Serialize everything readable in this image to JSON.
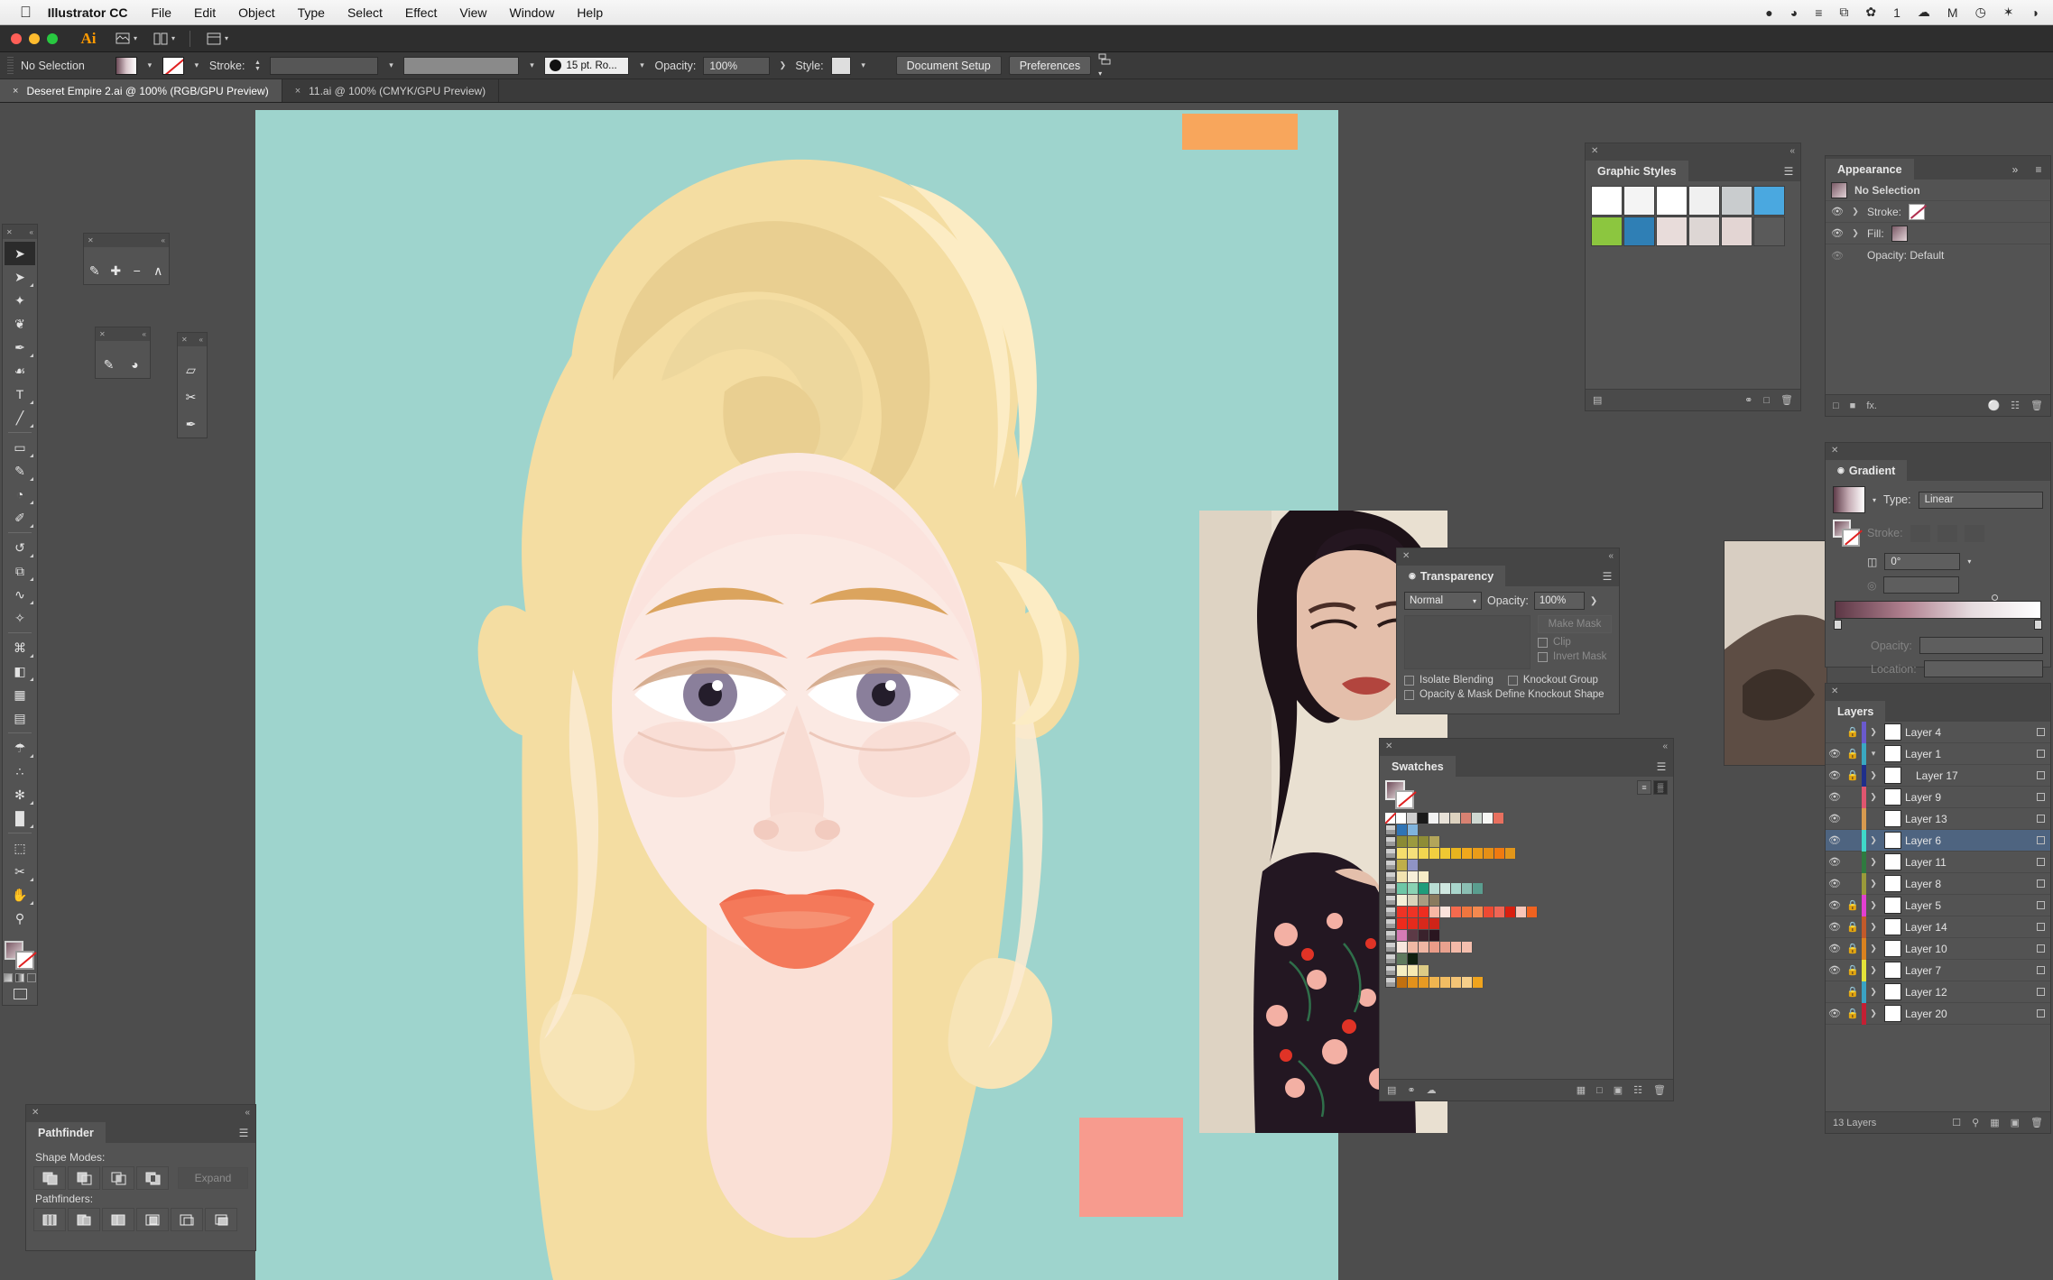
{
  "macbar": {
    "apple_icon": "apple-icon",
    "app_name": "Illustrator CC",
    "menus": [
      "File",
      "Edit",
      "Object",
      "Type",
      "Select",
      "Effect",
      "View",
      "Window",
      "Help"
    ],
    "status_items": [
      {
        "icon": "penguin-icon",
        "label": "●"
      },
      {
        "icon": "globe-icon",
        "label": "◕"
      },
      {
        "icon": "list-check-icon",
        "label": "≡"
      },
      {
        "icon": "screenshot-icon",
        "label": "⧉"
      },
      {
        "icon": "wechat-icon",
        "label": "✿"
      },
      {
        "icon": "count-badge",
        "label": "1"
      },
      {
        "icon": "cloud-icon",
        "label": "☁"
      },
      {
        "icon": "mendeley-icon",
        "label": "M"
      },
      {
        "icon": "clock-icon",
        "label": "◷"
      },
      {
        "icon": "bluetooth-icon",
        "label": "✶"
      },
      {
        "icon": "wifi-icon",
        "label": "◑"
      }
    ]
  },
  "appbar": {
    "logo_text": "Ai",
    "icons": [
      "bridge-icon",
      "arrange-documents-icon",
      "workspace-icon"
    ]
  },
  "controlbar": {
    "selection_status": "No Selection",
    "fill_label": "fill-swatch",
    "stroke_label": "Stroke:",
    "stroke_weight": "",
    "stroke_profile": "",
    "brush_definition": "15 pt. Ro...",
    "opacity_label": "Opacity:",
    "opacity_value": "100%",
    "style_label": "Style:",
    "document_setup_button": "Document Setup",
    "preferences_button": "Preferences"
  },
  "document_tabs": [
    {
      "title": "Deseret Empire 2.ai @ 100% (RGB/GPU Preview)",
      "active": true,
      "close": "×"
    },
    {
      "title": "11.ai @ 100% (CMYK/GPU Preview)",
      "active": false,
      "close": "×"
    }
  ],
  "toolbar": {
    "tools": [
      {
        "name": "selection-tool",
        "glyph": "➤",
        "selected": true,
        "arrow": false
      },
      {
        "name": "direct-selection-tool",
        "glyph": "➤",
        "selected": false,
        "arrow": true
      },
      {
        "name": "magic-wand-tool",
        "glyph": "✦",
        "selected": false,
        "arrow": false
      },
      {
        "name": "lasso-tool",
        "glyph": "❦",
        "selected": false,
        "arrow": false
      },
      {
        "name": "pen-tool",
        "glyph": "✒",
        "selected": false,
        "arrow": true
      },
      {
        "name": "curvature-tool",
        "glyph": "☙",
        "selected": false,
        "arrow": false
      },
      {
        "name": "type-tool",
        "glyph": "T",
        "selected": false,
        "arrow": true
      },
      {
        "name": "line-segment-tool",
        "glyph": "╱",
        "selected": false,
        "arrow": true
      },
      {
        "name": "rectangle-tool",
        "glyph": "▭",
        "selected": false,
        "arrow": true
      },
      {
        "name": "paintbrush-tool",
        "glyph": "✎",
        "selected": false,
        "arrow": true
      },
      {
        "name": "shaper-tool",
        "glyph": "◔",
        "selected": false,
        "arrow": true
      },
      {
        "name": "blob-brush-tool",
        "glyph": "✐",
        "selected": false,
        "arrow": true
      },
      {
        "name": "rotate-tool",
        "glyph": "↺",
        "selected": false,
        "arrow": true
      },
      {
        "name": "scale-tool",
        "glyph": "⧉",
        "selected": false,
        "arrow": true
      },
      {
        "name": "width-tool",
        "glyph": "∿",
        "selected": false,
        "arrow": true
      },
      {
        "name": "free-transform-tool",
        "glyph": "✧",
        "selected": false,
        "arrow": false
      },
      {
        "name": "shape-builder-tool",
        "glyph": "⌘",
        "selected": false,
        "arrow": true
      },
      {
        "name": "perspective-grid-tool",
        "glyph": "◧",
        "selected": false,
        "arrow": true
      },
      {
        "name": "mesh-tool",
        "glyph": "▦",
        "selected": false,
        "arrow": false
      },
      {
        "name": "gradient-tool",
        "glyph": "▤",
        "selected": false,
        "arrow": false
      },
      {
        "name": "eyedropper-tool",
        "glyph": "☂",
        "selected": false,
        "arrow": true
      },
      {
        "name": "blend-tool",
        "glyph": "∴",
        "selected": false,
        "arrow": false
      },
      {
        "name": "symbol-sprayer-tool",
        "glyph": "✻",
        "selected": false,
        "arrow": true
      },
      {
        "name": "column-graph-tool",
        "glyph": "█",
        "selected": false,
        "arrow": true
      },
      {
        "name": "artboard-tool",
        "glyph": "⬚",
        "selected": false,
        "arrow": false
      },
      {
        "name": "slice-tool",
        "glyph": "✂",
        "selected": false,
        "arrow": true
      },
      {
        "name": "hand-tool",
        "glyph": "✋",
        "selected": false,
        "arrow": true
      },
      {
        "name": "zoom-tool",
        "glyph": "⚲",
        "selected": false,
        "arrow": false
      }
    ]
  },
  "floating_panels": {
    "pen_group": {
      "title": "",
      "tools": [
        {
          "name": "pen-tool",
          "glyph": "✒"
        },
        {
          "name": "add-anchor-point-tool",
          "glyph": "✒"
        },
        {
          "name": "delete-anchor-point-tool",
          "glyph": "✒"
        },
        {
          "name": "anchor-point-tool",
          "glyph": "∧"
        }
      ]
    },
    "brush_group": {
      "title": "",
      "tools": [
        {
          "name": "paintbrush-tool",
          "glyph": "✎"
        },
        {
          "name": "blob-brush-tool",
          "glyph": "◖"
        }
      ]
    },
    "erase_group": {
      "title": "",
      "tools": [
        {
          "name": "eraser-tool",
          "glyph": "▱"
        },
        {
          "name": "scissors-tool",
          "glyph": "✂"
        },
        {
          "name": "knife-tool",
          "glyph": "✒"
        }
      ]
    }
  },
  "pathfinder": {
    "tab": "Pathfinder",
    "shape_modes_label": "Shape Modes:",
    "pathfinders_label": "Pathfinders:",
    "expand_button": "Expand",
    "shape_modes": [
      "unite",
      "minus-front",
      "intersect",
      "exclude"
    ],
    "pathfinder_ops": [
      "divide",
      "trim",
      "merge",
      "crop",
      "outline",
      "minus-back"
    ]
  },
  "graphic_styles": {
    "tab": "Graphic Styles",
    "swatches": [
      {
        "name": "default-style",
        "color": "#ffffff"
      },
      {
        "name": "none-style",
        "color": "#f4f4f4"
      },
      {
        "name": "white-fill-style",
        "color": "#ffffff"
      },
      {
        "name": "dashed-style",
        "color": "#f0f0f0"
      },
      {
        "name": "soft-gray-style",
        "color": "#c9ccce"
      },
      {
        "name": "blue-gel-style",
        "color": "#4aa8e0"
      },
      {
        "name": "green-swirl-style",
        "color": "#8cc63f"
      },
      {
        "name": "blue-swirl-style",
        "color": "#2f7fb5"
      },
      {
        "name": "pale-pink-style",
        "color": "#e8dcda"
      },
      {
        "name": "pale-neutral-style",
        "color": "#ddd6d4"
      },
      {
        "name": "pale-rose-style",
        "color": "#e3d5d3"
      },
      {
        "name": "empty-style",
        "color": "#5a5a5a"
      }
    ]
  },
  "appearance": {
    "tab": "Appearance",
    "target": "No Selection",
    "rows": [
      {
        "label": "Stroke:",
        "kind": "stroke"
      },
      {
        "label": "Fill:",
        "kind": "fill"
      },
      {
        "label": "Opacity: Default",
        "kind": "opacity"
      }
    ],
    "collapse_icon": "»",
    "menu_icon": "≡"
  },
  "gradient": {
    "tab": "Gradient",
    "type_label": "Type:",
    "type_value": "Linear",
    "stroke_label": "Stroke:",
    "angle_label": "angle-icon",
    "angle_value": "0°",
    "aspect_label": "aspect-ratio-icon",
    "aspect_value": "",
    "opacity_label": "Opacity:",
    "opacity_value": "",
    "location_label": "Location:",
    "location_value": "",
    "ramp_from": "#5c3745",
    "ramp_to": "#ffffff"
  },
  "transparency": {
    "tab": "Transparency",
    "blend_mode": "Normal",
    "opacity_label": "Opacity:",
    "opacity_value": "100%",
    "make_mask_button": "Make Mask",
    "clip_label": "Clip",
    "invert_mask_label": "Invert Mask",
    "isolate_blending_label": "Isolate Blending",
    "knockout_group_label": "Knockout Group",
    "knockout_shape_label": "Opacity & Mask Define Knockout Shape"
  },
  "swatches": {
    "tab": "Swatches",
    "view_list_icon": "≡",
    "view_grid_icon": "▒",
    "rows": [
      {
        "group": false,
        "colors": [
          "#ffffff",
          "#cfcfcf",
          "#1a1a1a",
          "#f2f2f2",
          "#e8e2d8",
          "#ddd2bf",
          "#d88272",
          "#cfd8d1",
          "#f7f7f4",
          "#e8705f"
        ]
      },
      {
        "group": true,
        "colors": [
          "#2f74b5",
          "#7fb3dd"
        ]
      },
      {
        "group": true,
        "colors": [
          "#8b8a35",
          "#9c9a3f",
          "#8e8c36",
          "#b3a55a"
        ]
      },
      {
        "group": true,
        "colors": [
          "#f5dd6c",
          "#f6e07a",
          "#f3d650",
          "#f2cf40",
          "#f0c832",
          "#e8b41e",
          "#f0a81c",
          "#ea9c19",
          "#e58f16",
          "#f07a10",
          "#e2961a"
        ]
      },
      {
        "group": true,
        "colors": [
          "#bfae4a",
          "#8f93c4"
        ]
      },
      {
        "group": true,
        "colors": [
          "#f2e3b0",
          "#f7efd9",
          "#f6ecc7"
        ]
      },
      {
        "group": true,
        "colors": [
          "#6ec7a6",
          "#8ad2b3",
          "#1f9c7a",
          "#b9ded4",
          "#cfe7e0",
          "#a9d6cc",
          "#8bbfb3",
          "#5a9e8f"
        ]
      },
      {
        "group": true,
        "colors": [
          "#f5f0d8",
          "#d9d3bb",
          "#a89c82",
          "#8a7a5e"
        ]
      },
      {
        "group": true,
        "colors": [
          "#ef3325",
          "#ef3325",
          "#ee2d20",
          "#f9b6a4",
          "#fbe3dc",
          "#f56a4e",
          "#f0763f",
          "#f4894f",
          "#ee4a33",
          "#ef6656",
          "#d81f0f",
          "#f9c6b9",
          "#f0621f"
        ]
      },
      {
        "group": true,
        "colors": [
          "#ef2a1c",
          "#e52a1c",
          "#d8281b",
          "#cf2418"
        ]
      },
      {
        "group": true,
        "colors": [
          "#d57bb4",
          "#5c3a46",
          "#3a222c",
          "#2a1620"
        ]
      },
      {
        "group": true,
        "colors": [
          "#f7e7de",
          "#efb9a4",
          "#f0b6a3",
          "#ea9c88",
          "#e8a18e",
          "#f3b9a8",
          "#f5bfae"
        ]
      },
      {
        "group": true,
        "colors": [
          "#5f7a5e",
          "#10200f"
        ]
      },
      {
        "group": true,
        "colors": [
          "#f6eec2",
          "#f6e9b2",
          "#dccb85"
        ]
      },
      {
        "group": true,
        "colors": [
          "#c2700f",
          "#e2911b",
          "#e79a22",
          "#f0b550",
          "#f2bd63",
          "#f3c476",
          "#f6cf8a",
          "#f0a41d"
        ]
      }
    ],
    "footer_icons": [
      "swatch-libraries-icon",
      "show-swatch-kinds-icon",
      "swatch-options-icon",
      "new-color-group-icon",
      "new-swatch-icon",
      "delete-swatch-icon"
    ]
  },
  "layers": {
    "tab": "Layers",
    "count_label": "13 Layers",
    "footer_icons": [
      "make-clipping-mask-icon",
      "locate-object-icon",
      "create-sublayer-icon",
      "create-new-layer-icon",
      "delete-selection-icon"
    ],
    "rows": [
      {
        "name": "Layer 4",
        "visible": false,
        "locked": true,
        "expandable": true,
        "expanded": false,
        "selected": false,
        "sub": false,
        "color": "#6a5acd"
      },
      {
        "name": "Layer 1",
        "visible": true,
        "locked": true,
        "expandable": true,
        "expanded": true,
        "selected": false,
        "sub": false,
        "color": "#3aa8c1"
      },
      {
        "name": "Layer 17",
        "visible": true,
        "locked": true,
        "expandable": true,
        "expanded": false,
        "selected": false,
        "sub": true,
        "color": "#1f2f8a"
      },
      {
        "name": "Layer 9",
        "visible": true,
        "locked": false,
        "expandable": true,
        "expanded": false,
        "selected": false,
        "sub": false,
        "color": "#e0566f"
      },
      {
        "name": "Layer 13",
        "visible": true,
        "locked": false,
        "expandable": false,
        "expanded": false,
        "selected": false,
        "sub": false,
        "color": "#d79a4f"
      },
      {
        "name": "Layer 6",
        "visible": true,
        "locked": false,
        "expandable": true,
        "expanded": false,
        "selected": true,
        "sub": false,
        "color": "#3fd9c9"
      },
      {
        "name": "Layer 11",
        "visible": true,
        "locked": false,
        "expandable": true,
        "expanded": false,
        "selected": false,
        "sub": false,
        "color": "#2f7a3f"
      },
      {
        "name": "Layer 8",
        "visible": true,
        "locked": false,
        "expandable": true,
        "expanded": false,
        "selected": false,
        "sub": false,
        "color": "#9a9a3a"
      },
      {
        "name": "Layer 5",
        "visible": true,
        "locked": true,
        "expandable": true,
        "expanded": false,
        "selected": false,
        "sub": false,
        "color": "#e23fd1"
      },
      {
        "name": "Layer 14",
        "visible": true,
        "locked": true,
        "expandable": true,
        "expanded": false,
        "selected": false,
        "sub": false,
        "color": "#c35a2a"
      },
      {
        "name": "Layer 10",
        "visible": true,
        "locked": true,
        "expandable": true,
        "expanded": false,
        "selected": false,
        "sub": false,
        "color": "#d9821f"
      },
      {
        "name": "Layer 7",
        "visible": true,
        "locked": true,
        "expandable": true,
        "expanded": false,
        "selected": false,
        "sub": false,
        "color": "#e3e339"
      },
      {
        "name": "Layer 12",
        "visible": false,
        "locked": true,
        "expandable": true,
        "expanded": false,
        "selected": false,
        "sub": false,
        "color": "#3aa3c4"
      },
      {
        "name": "Layer 20",
        "visible": true,
        "locked": true,
        "expandable": true,
        "expanded": false,
        "selected": false,
        "sub": false,
        "color": "#c41f33"
      }
    ]
  },
  "artwork": {
    "background_color": "#9ed4cd",
    "hair_color": "#f4dda2",
    "hair_shadow": "#e3c583",
    "skin_color": "#fbe6df",
    "lips_color": "#f4795a",
    "eye_iris": "#8a7f9b",
    "accent_orange": "#f8a65c",
    "accent_gold": "#e9c98d",
    "accent_pink": "#f79b8e"
  }
}
